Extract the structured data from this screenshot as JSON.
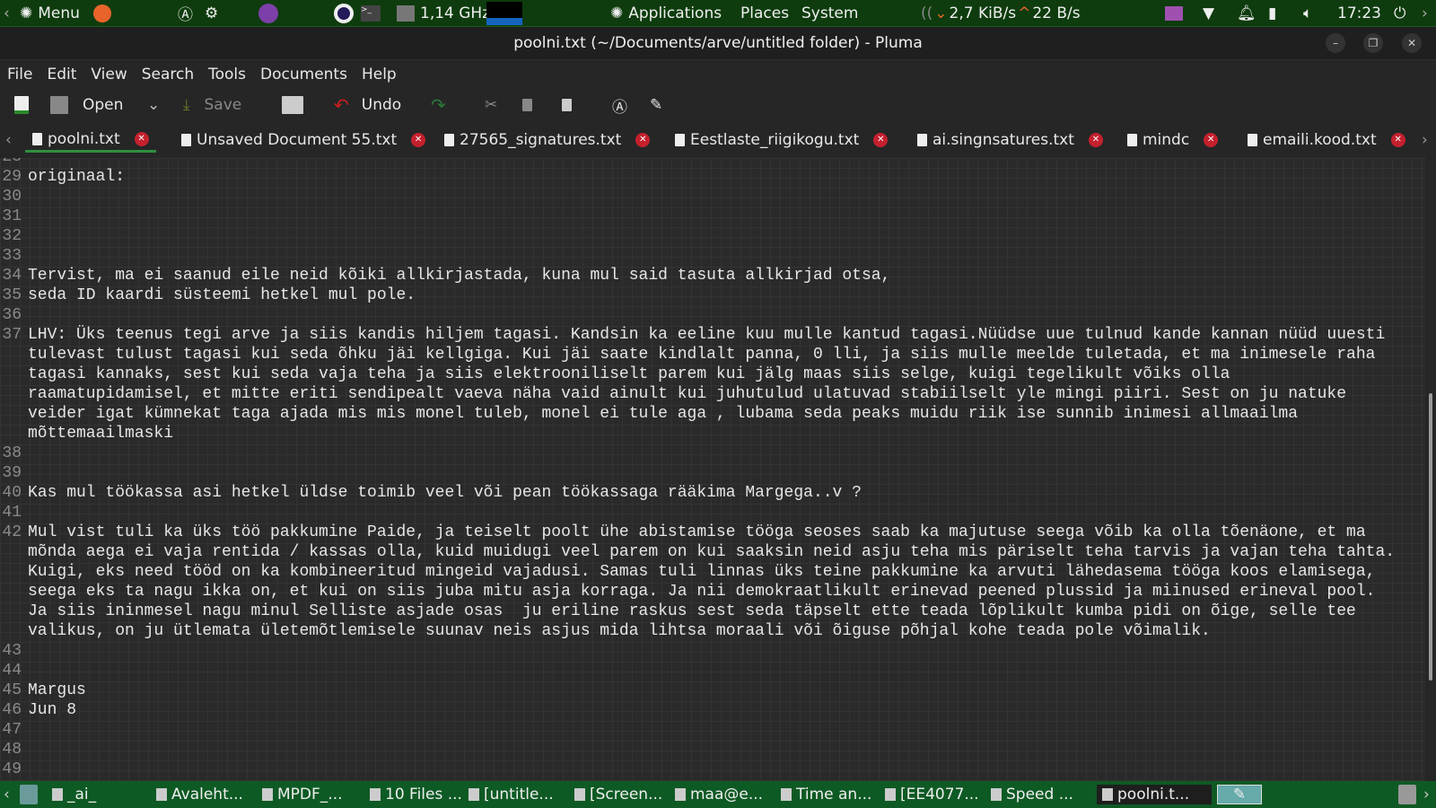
{
  "top_panel": {
    "menu": "Menu",
    "cpu": "1,14 GHz",
    "applications": "Applications",
    "places": "Places",
    "system": "System",
    "net_down": "2,7 KiB/s",
    "net_up": "22 B/s",
    "clock": "17:23"
  },
  "window": {
    "title": "poolni.txt (~/Documents/arve/untitled folder) - Pluma"
  },
  "menu": [
    "File",
    "Edit",
    "View",
    "Search",
    "Tools",
    "Documents",
    "Help"
  ],
  "toolbar": {
    "open": "Open",
    "save": "Save",
    "undo": "Undo"
  },
  "tabs": [
    {
      "label": "poolni.txt",
      "active": true
    },
    {
      "label": "Unsaved Document 55.txt"
    },
    {
      "label": "27565_signatures.txt"
    },
    {
      "label": "Eestlaste_riigikogu.txt"
    },
    {
      "label": "ai.singnsatures.txt"
    },
    {
      "label": "mindc"
    },
    {
      "label": "emaili.kood.txt"
    }
  ],
  "editor": {
    "scroll_position_percent": 70,
    "lines": [
      {
        "num": "28",
        "segments": [
          ""
        ]
      },
      {
        "num": "29",
        "segments": [
          "originaal:"
        ]
      },
      {
        "num": "30",
        "segments": [
          ""
        ]
      },
      {
        "num": "31",
        "segments": [
          ""
        ]
      },
      {
        "num": "32",
        "segments": [
          ""
        ]
      },
      {
        "num": "33",
        "segments": [
          ""
        ]
      },
      {
        "num": "34",
        "segments": [
          "Tervist, ma ei saanud eile neid kõiki allkirjastada, kuna mul said tasuta allkirjad otsa,"
        ]
      },
      {
        "num": "35",
        "segments": [
          "seda ID kaardi süsteemi hetkel mul pole."
        ]
      },
      {
        "num": "36",
        "segments": [
          ""
        ]
      },
      {
        "num": "37",
        "segments": [
          "LHV: Üks teenus tegi arve ja siis kandis hiljem tagasi. Kandsin ka eeline kuu mulle kantud tagasi.Nüüdse uue tulnud kande kannan nüüd uuesti",
          "tulevast tulust tagasi kui seda õhku jäi kellgiga. Kui jäi saate kindlalt panna, 0 lli, ja siis mulle meelde tuletada, et ma inimesele raha",
          "tagasi kannaks, sest kui seda vaja teha ja siis elektrooniliselt parem kui jälg maas siis selge, kuigi tegelikult võiks olla",
          "raamatupidamisel, et mitte eriti sendipealt vaeva näha vaid ainult kui juhutulud ulatuvad stabiilselt yle mingi piiri. Sest on ju natuke",
          "veider igat kümnekat taga ajada mis mis monel tuleb, monel ei tule aga , lubama seda peaks muidu riik ise sunnib inimesi allmaailma",
          "mõttemaailmaski"
        ]
      },
      {
        "num": "38",
        "segments": [
          ""
        ]
      },
      {
        "num": "39",
        "segments": [
          ""
        ]
      },
      {
        "num": "40",
        "segments": [
          "Kas mul töökassa asi hetkel üldse toimib veel või pean töökassaga rääkima Margega..v ?"
        ]
      },
      {
        "num": "41",
        "segments": [
          ""
        ]
      },
      {
        "num": "42",
        "segments": [
          "Mul vist tuli ka üks töö pakkumine Paide, ja teiselt poolt ühe abistamise tööga seoses saab ka majutuse seega võib ka olla tõenäone, et ma",
          "mõnda aega ei vaja rentida / kassas olla, kuid muidugi veel parem on kui saaksin neid asju teha mis päriselt teha tarvis ja vajan teha tahta.",
          "Kuigi, eks need tööd on ka kombineeritud mingeid vajadusi. Samas tuli linnas üks teine pakkumine ka arvuti lähedasema tööga koos elamisega,",
          "seega eks ta nagu ikka on, et kui on siis juba mitu asja korraga. Ja nii demokraatlikult erinevad peened plussid ja miinused erineval pool.",
          "Ja siis ininmesel nagu minul Selliste asjade osas  ju eriline raskus sest seda täpselt ette teada lõplikult kumba pidi on õige, selle tee",
          "valikus, on ju ütlemata ületemõtlemisele suunav neis asjus mida lihtsa moraali või õiguse põhjal kohe teada pole võimalik."
        ]
      },
      {
        "num": "43",
        "segments": [
          ""
        ]
      },
      {
        "num": "44",
        "segments": [
          ""
        ]
      },
      {
        "num": "45",
        "segments": [
          "Margus"
        ]
      },
      {
        "num": "46",
        "segments": [
          "Jun 8"
        ]
      },
      {
        "num": "47",
        "segments": [
          ""
        ]
      },
      {
        "num": "48",
        "segments": [
          ""
        ]
      },
      {
        "num": "49",
        "segments": [
          ""
        ]
      }
    ]
  },
  "taskbar": [
    "_ai_",
    "Avaleht...",
    "MPDF_...",
    "10 Files ...",
    "[untitle...",
    "[Screen...",
    "maa@e...",
    "Time an...",
    "[EE4077...",
    "Speed ...",
    "poolni.t..."
  ],
  "colors": {
    "panel": "#0e3c0e",
    "taskbar": "#0e5a24",
    "tab_close": "#c4202e",
    "active_tab": "#2f8f3f"
  }
}
